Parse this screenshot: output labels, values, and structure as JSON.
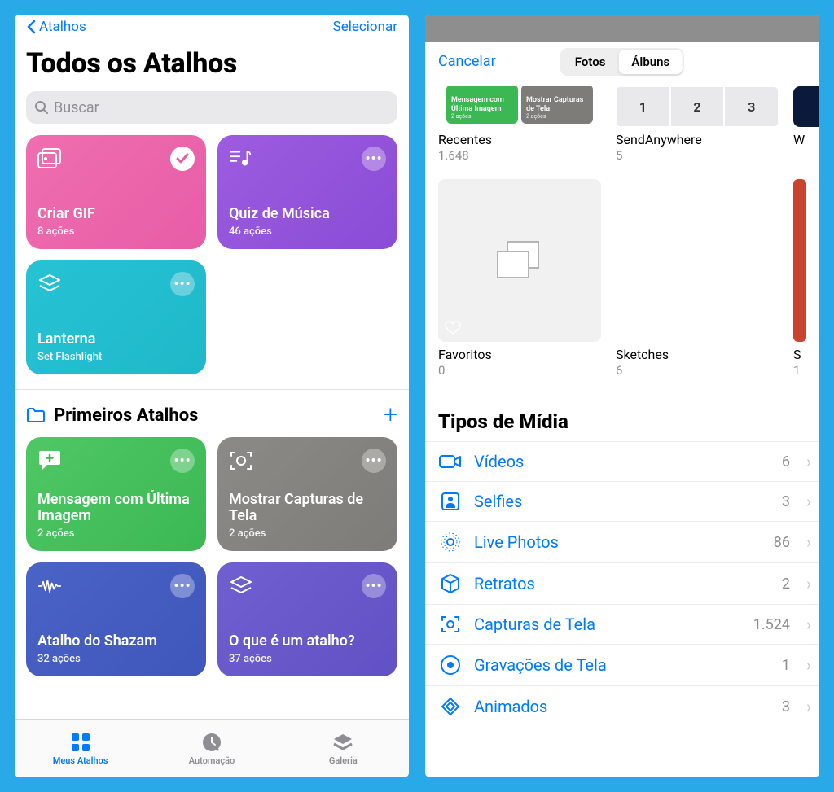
{
  "left": {
    "nav_back": "Atalhos",
    "nav_select": "Selecionar",
    "title": "Todos os Atalhos",
    "search_placeholder": "Buscar",
    "tiles_top": [
      {
        "title": "Criar GIF",
        "sub": "8 ações"
      },
      {
        "title": "Quiz de Música",
        "sub": "46 ações"
      },
      {
        "title": "Lanterna",
        "sub": "Set Flashlight"
      }
    ],
    "section": {
      "name": "Primeiros Atalhos"
    },
    "tiles_bottom": [
      {
        "title": "Mensagem com Última Imagem",
        "sub": "2 ações"
      },
      {
        "title": "Mostrar Capturas de Tela",
        "sub": "2 ações"
      },
      {
        "title": "Atalho do Shazam",
        "sub": "32 ações"
      },
      {
        "title": "O que é um atalho?",
        "sub": "37 ações"
      }
    ],
    "tabs": {
      "my": "Meus Atalhos",
      "auto": "Automação",
      "gallery": "Galeria"
    }
  },
  "right": {
    "cancel": "Cancelar",
    "seg_photos": "Fotos",
    "seg_albums": "Álbuns",
    "row1": [
      {
        "name": "Recentes",
        "count": "1.648",
        "mini": [
          {
            "title": "Mensagem com Última Imagem",
            "sub": "2 ações"
          },
          {
            "title": "Mostrar Capturas de Tela",
            "sub": "2 ações"
          }
        ]
      },
      {
        "name": "SendAnywhere",
        "count": "5",
        "nums": [
          "1",
          "2",
          "3"
        ]
      },
      {
        "name": "W",
        "count": ""
      }
    ],
    "row2": [
      {
        "name": "Favoritos",
        "count": "0"
      },
      {
        "name": "Sketches",
        "count": "6"
      },
      {
        "name": "S",
        "count": "1"
      }
    ],
    "media_title": "Tipos de Mídia",
    "media": [
      {
        "name": "Vídeos",
        "count": "6"
      },
      {
        "name": "Selfies",
        "count": "3"
      },
      {
        "name": "Live Photos",
        "count": "86"
      },
      {
        "name": "Retratos",
        "count": "2"
      },
      {
        "name": "Capturas de Tela",
        "count": "1.524"
      },
      {
        "name": "Gravações de Tela",
        "count": "1"
      },
      {
        "name": "Animados",
        "count": "3"
      }
    ]
  }
}
